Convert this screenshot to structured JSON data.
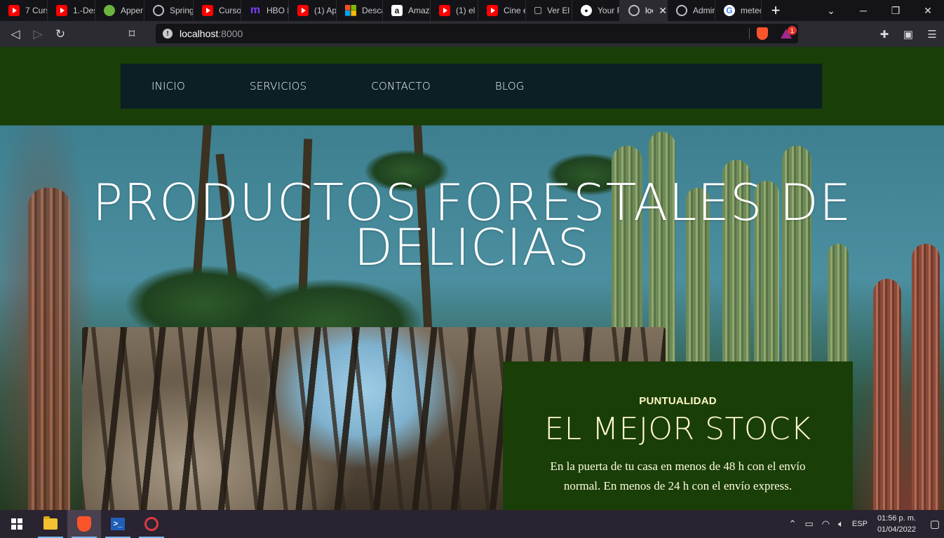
{
  "browser": {
    "tabs": [
      {
        "label": "7 Curs",
        "icon": "youtube-icon"
      },
      {
        "label": "1.-Des",
        "icon": "youtube-icon"
      },
      {
        "label": "Apper",
        "icon": "spring-leaf-icon"
      },
      {
        "label": "Spring",
        "icon": "globe-icon"
      },
      {
        "label": "Curso",
        "icon": "youtube-icon"
      },
      {
        "label": "HBO M",
        "icon": "hbo-max-icon"
      },
      {
        "label": "(1) Ap",
        "icon": "youtube-icon"
      },
      {
        "label": "Desca",
        "icon": "microsoft-icon"
      },
      {
        "label": "Amaz",
        "icon": "amazon-icon"
      },
      {
        "label": "(1) el",
        "icon": "youtube-icon"
      },
      {
        "label": "Cine e",
        "icon": "youtube-icon"
      },
      {
        "label": "Ver El",
        "icon": "page-icon"
      },
      {
        "label": "Your F",
        "icon": "github-icon"
      },
      {
        "label": "loc",
        "icon": "globe-icon",
        "active": true
      },
      {
        "label": "Admir",
        "icon": "globe-icon"
      },
      {
        "label": "metec",
        "icon": "google-icon"
      }
    ],
    "new_tab_label": "+",
    "address": {
      "host": "localhost",
      "port": ":8000"
    },
    "rewards_badge": "1"
  },
  "site": {
    "nav": [
      {
        "label": "INICIO"
      },
      {
        "label": "SERVICIOS"
      },
      {
        "label": "CONTACTO"
      },
      {
        "label": "BLOG"
      }
    ],
    "hero_title_line1": "PRODUCTOS FORESTALES DE",
    "hero_title_line2": "DELICIAS",
    "card": {
      "eyebrow": "PUNTUALIDAD",
      "heading": "EL MEJOR STOCK",
      "body": "En la puerta de tu casa en menos de 48 h con el envío normal. En menos de 24 h con el envío express."
    },
    "colors": {
      "header_green": "#1a3e08",
      "nav_dark": "#0b1f25",
      "card_text": "#fffbe0"
    }
  },
  "taskbar": {
    "language": "ESP",
    "time": "01:56 p. m.",
    "date": "01/04/2022"
  }
}
